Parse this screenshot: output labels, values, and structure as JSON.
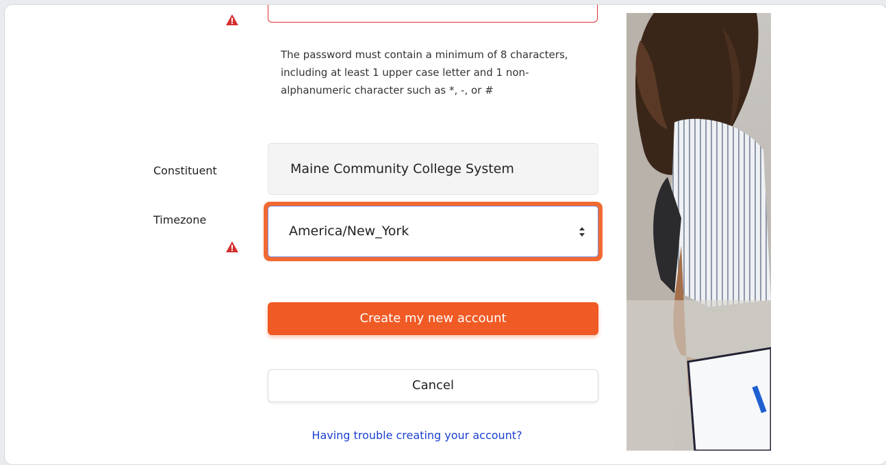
{
  "form": {
    "password_hint": "The password must contain a minimum of 8 characters, including at least 1 upper case letter and 1 non-alphanumeric character such as *, -, or #",
    "constituent": {
      "label": "Constituent",
      "value": "Maine Community College System"
    },
    "timezone": {
      "label": "Timezone",
      "value": "America/New_York"
    },
    "submit_label": "Create my new account",
    "cancel_label": "Cancel",
    "help_link": "Having trouble creating your account?"
  },
  "icons": {
    "error": "warning-triangle-icon",
    "select": "updown-arrows-icon"
  },
  "colors": {
    "accent": "#f05a24",
    "error": "#e02e2e",
    "link": "#1a3fd1",
    "focus_ring": "#f26a32"
  }
}
